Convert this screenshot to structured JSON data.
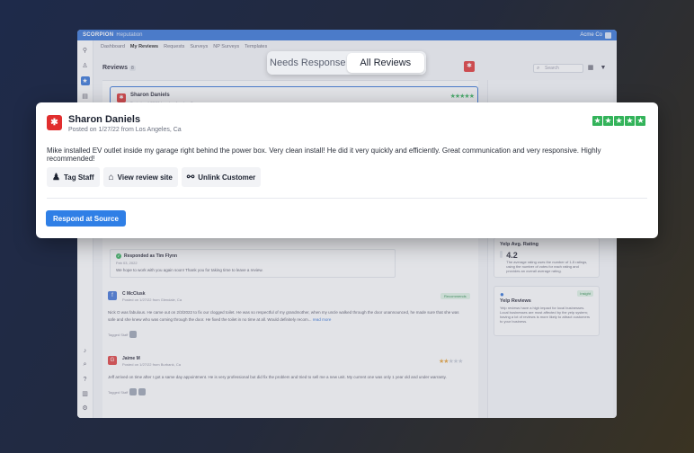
{
  "app": {
    "brand": "SCORPION",
    "product": "Reputation",
    "account": "Acme Co"
  },
  "subnav": [
    "Dashboard",
    "My Reviews",
    "Requests",
    "Surveys",
    "NP Surveys",
    "Templates"
  ],
  "reviews_header": {
    "title": "Reviews",
    "count": "8"
  },
  "search": {
    "placeholder": "Search"
  },
  "segmented": {
    "options": [
      "Needs Response",
      "All Reviews"
    ],
    "selected": "All Reviews"
  },
  "featured_review": {
    "name": "Sharon Daniels",
    "meta": "Posted on 1/27/22 from Los Angeles, Ca",
    "stars": 5,
    "text": "Mike installed EV outlet inside my garage right behind the power box. Very clean install! He did it very quickly and efficiently. Great communication and very responsive. Highly recommended!",
    "actions": {
      "tag_staff": "Tag Staff",
      "view_site": "View review site",
      "unlink": "Unlink Customer"
    },
    "respond_label": "Respond at Source"
  },
  "bg_first": {
    "name": "Sharon Daniels",
    "meta": "Posted on 1/27/22 from Los Angeles, Ca"
  },
  "responded": {
    "title": "Responded as Tim Flynn",
    "date": "Feb 03, 2022",
    "text": "We hope to work with you again soon! Thank you for taking time to leave a review."
  },
  "review2": {
    "name": "C McClusk",
    "meta": "Posted on 1/27/22 from Glendale, Ca",
    "badge": "Recommends",
    "text": "Nick O was fabulous. He came out on 2/3/2022 to fix our clogged toilet. He was so respectful of my grandmother, when my uncle walked through the door unannounced, he made sure that she was safe and she knew who was coming through the door. He fixed the toilet in no time at all. Would definitely recom...",
    "read_more": "read more",
    "tagged": "Tagged Staff"
  },
  "review3": {
    "name": "Jaime M",
    "meta": "Posted on 1/27/22 from Burbank, Ca",
    "stars": 2,
    "text": "Jeff arrived on time after I got a same day appointment. He is very professional but did fix the problem and tried to sell me a new unit. My current one was only 1 year old and under warranty.",
    "tagged": "Tagged Staff"
  },
  "right_cards": {
    "avg": {
      "title": "Yelp Avg. Rating",
      "value": "4.2",
      "desc": "The average rating uses the number of 1-5 ratings, using the number of votes for each rating and provides an overall average rating."
    },
    "yelp": {
      "title": "Yelp Reviews",
      "badge": "Insight",
      "desc": "Yelp reviews have a high impact for local businesses. Local businesses are most affected by the yelp system; having a lot of reviews is more likely to attract customers to your business."
    }
  },
  "colors": {
    "brand_blue": "#2f6fd6",
    "yelp_red": "#e12e2e",
    "star_green": "#33b35a",
    "star_orange": "#e8a23a"
  }
}
